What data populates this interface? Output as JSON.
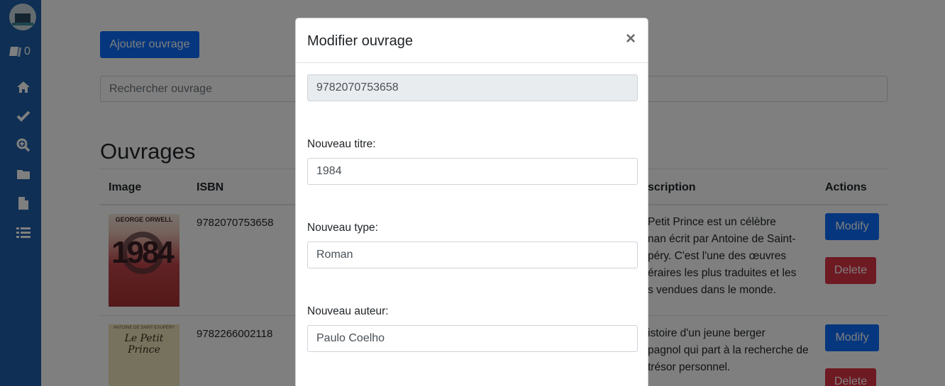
{
  "sidebar": {
    "cart_count": "0",
    "items": [
      "home-icon",
      "check-icon",
      "search-plus-icon",
      "folder-icon",
      "file-icon",
      "list-icon"
    ]
  },
  "page": {
    "add_button": "Ajouter ouvrage",
    "search_placeholder": "Rechercher ouvrage",
    "heading": "Ouvrages",
    "columns": {
      "image": "Image",
      "isbn": "ISBN",
      "description": "scription",
      "actions": "Actions"
    },
    "rows": [
      {
        "isbn": "9782070753658",
        "cover_author": "GEORGE ORWELL",
        "cover_title": "1984",
        "desc_lines": [
          "Petit Prince est un célèbre",
          "nan écrit par Antoine de Saint-",
          "péry. C'est l'une des œuvres",
          "éraires les plus traduites et les",
          "s vendues dans le monde."
        ],
        "modify": "Modify",
        "delete": "Delete"
      },
      {
        "isbn": "9782266002118",
        "cover_author": "ANTOINE DE SAINT-EXUPÉRY",
        "cover_title": "Le Petit Prince",
        "desc_lines": [
          "istoire d'un jeune berger",
          "pagnol qui part à la recherche de",
          "trésor personnel."
        ],
        "modify": "Modify",
        "delete": "Delete"
      }
    ]
  },
  "modal": {
    "title": "Modifier ouvrage",
    "close": "×",
    "isbn_value": "9782070753658",
    "titre_label": "Nouveau titre:",
    "titre_value": "1984",
    "type_label": "Nouveau type:",
    "type_value": "Roman",
    "auteur_label": "Nouveau auteur:",
    "auteur_value": "Paulo Coelho"
  },
  "colors": {
    "sidebar": "#1f5fa8",
    "primary": "#0d6efd",
    "danger": "#dc3545",
    "overlay": "rgba(0,0,0,0.5)"
  }
}
